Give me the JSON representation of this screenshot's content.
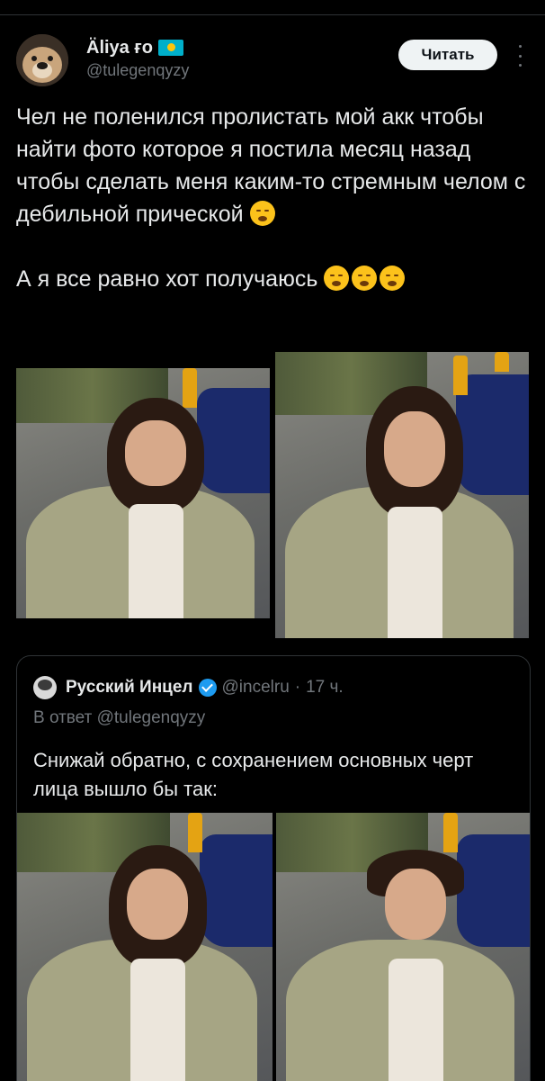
{
  "tweet": {
    "author": {
      "display_name": "Äliya ғo",
      "handle": "@tulegenqyzy",
      "flag_icon": "kazakhstan-flag-icon",
      "flag_colors": {
        "field": "#00afca",
        "sun": "#fec50c"
      }
    },
    "follow_label": "Читать",
    "more_icon": "more-vertical-icon",
    "paragraph_1": "Чел не поленился пролистать мой акк чтобы найти фото которое я постила месяц назад чтобы сделать меня каким-то стремным челом с дебильной прической",
    "paragraph_2": "А я все равно хот получаюсь",
    "emoji_icon": "face-exhaling-emoji-icon",
    "photos": [
      {
        "label": "selfie-woman"
      },
      {
        "label": "selfie-man-long-curly-hair"
      }
    ]
  },
  "quote": {
    "author": {
      "display_name": "Русский Инцел",
      "handle": "@incelru",
      "separator": "·",
      "time": "17 ч.",
      "verified_icon": "verified-badge-icon"
    },
    "reply_prefix": "В ответ",
    "reply_to": "@tulegenqyzy",
    "text": "Снижай обратно, с сохранением основных черт лица вышло бы так:",
    "photos": [
      {
        "label": "selfie-woman"
      },
      {
        "label": "selfie-man-short-hair"
      }
    ]
  },
  "colors": {
    "background": "#000000",
    "text": "#e7e9ea",
    "muted": "#71767b",
    "border": "#2f3336",
    "verified": "#1d9bf0",
    "follow_button_bg": "#eff3f4"
  }
}
